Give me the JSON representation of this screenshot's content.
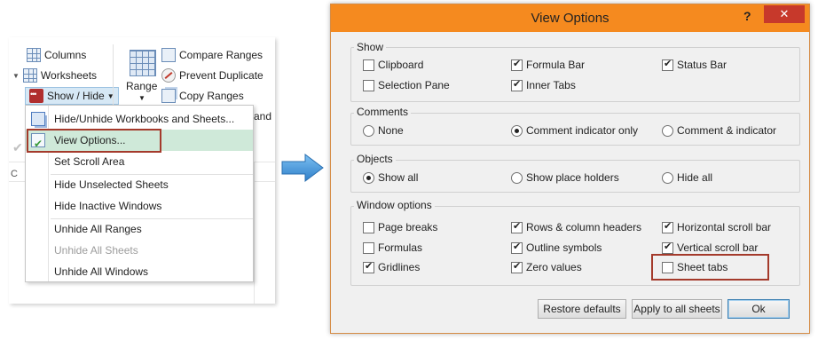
{
  "ribbon": {
    "columns_label": "Columns",
    "worksheets_label": "Worksheets",
    "show_hide_label": "Show / Hide",
    "range_label": "Range",
    "compare_label": "Compare Ranges",
    "prevent_label": "Prevent Duplicate",
    "copy_label": "Copy Ranges",
    "partial_label": "and"
  },
  "menu": {
    "items": [
      {
        "label": "Hide/Unhide Workbooks and Sheets...",
        "icon": "unhide-workbooks-icon"
      },
      {
        "label": "View Options...",
        "icon": "view-options-icon"
      },
      {
        "label": "Set Scroll Area"
      },
      {
        "label": "Hide Unselected Sheets"
      },
      {
        "label": "Hide Inactive Windows"
      },
      {
        "label": "Unhide All Ranges"
      },
      {
        "label": "Unhide All Sheets"
      },
      {
        "label": "Unhide All Windows"
      }
    ]
  },
  "sheet": {
    "col_c": "C"
  },
  "dialog": {
    "title": "View Options",
    "help": "?",
    "close": "✕",
    "show": {
      "title": "Show",
      "clipboard": {
        "label": "Clipboard",
        "checked": false
      },
      "formula_bar": {
        "label": "Formula Bar",
        "checked": true
      },
      "status_bar": {
        "label": "Status Bar",
        "checked": true
      },
      "selection_pane": {
        "label": "Selection Pane",
        "checked": false
      },
      "inner_tabs": {
        "label": "Inner Tabs",
        "checked": true
      }
    },
    "comments": {
      "title": "Comments",
      "none": {
        "label": "None",
        "selected": false
      },
      "indicator_only": {
        "label": "Comment indicator only",
        "selected": true
      },
      "comment_indicator": {
        "label": "Comment & indicator",
        "selected": false
      }
    },
    "objects": {
      "title": "Objects",
      "show_all": {
        "label": "Show all",
        "selected": true
      },
      "placeholders": {
        "label": "Show place holders",
        "selected": false
      },
      "hide_all": {
        "label": "Hide all",
        "selected": false
      }
    },
    "window": {
      "title": "Window options",
      "page_breaks": {
        "label": "Page breaks",
        "checked": false
      },
      "rc_headers": {
        "label": "Rows & column headers",
        "checked": true
      },
      "h_scroll": {
        "label": "Horizontal scroll bar",
        "checked": true
      },
      "formulas": {
        "label": "Formulas",
        "checked": false
      },
      "outline": {
        "label": "Outline symbols",
        "checked": true
      },
      "v_scroll": {
        "label": "Vertical scroll bar",
        "checked": true
      },
      "gridlines": {
        "label": "Gridlines",
        "checked": true
      },
      "zero_values": {
        "label": "Zero values",
        "checked": true
      },
      "sheet_tabs": {
        "label": "Sheet tabs",
        "checked": false
      }
    },
    "buttons": {
      "restore": "Restore defaults",
      "apply_all": "Apply to all sheets",
      "ok": "Ok"
    }
  },
  "colors": {
    "titlebar": "#f58a1f",
    "close": "#c7392b",
    "highlight_box": "#a43a2b",
    "menu_highlight": "#cfe9d9",
    "arrow": "#3d8fd6"
  }
}
